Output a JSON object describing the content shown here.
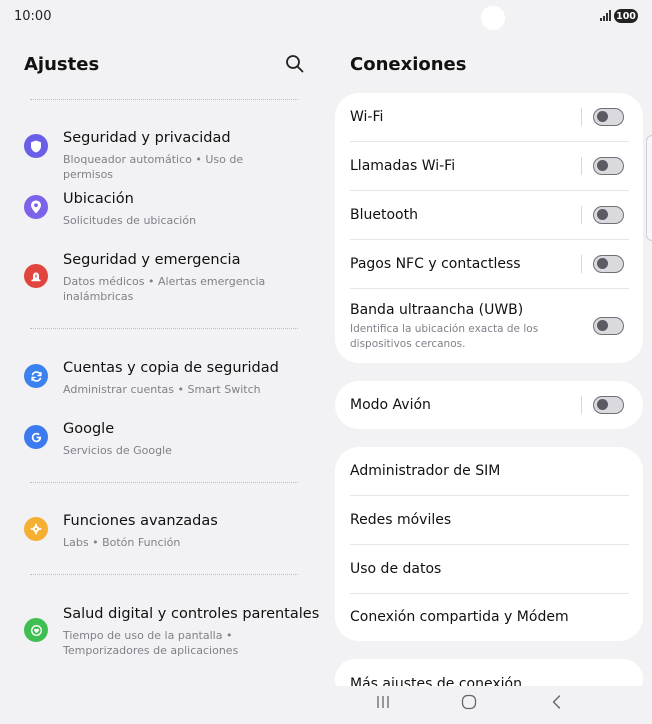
{
  "status_bar": {
    "time": "10:00",
    "battery": "100"
  },
  "settings": {
    "title": "Ajustes",
    "groups": [
      {
        "items": [
          {
            "title": "Seguridad y privacidad",
            "subtitle": "Bloqueador automático • Uso de permisos",
            "icon": "shield-icon",
            "color": "#6a5ee8"
          },
          {
            "title": "Ubicación",
            "subtitle": "Solicitudes de ubicación",
            "icon": "location-pin-icon",
            "color": "#7d62ea"
          },
          {
            "title": "Seguridad y emergencia",
            "subtitle": "Datos médicos • Alertas emergencia inalámbricas",
            "icon": "emergency-icon",
            "color": "#e0463d"
          }
        ]
      },
      {
        "items": [
          {
            "title": "Cuentas y copia de seguridad",
            "subtitle": "Administrar cuentas • Smart Switch",
            "icon": "sync-icon",
            "color": "#3c82ee"
          },
          {
            "title": "Google",
            "subtitle": "Servicios de Google",
            "icon": "google-icon",
            "color": "#3c7bef"
          }
        ]
      },
      {
        "items": [
          {
            "title": "Funciones avanzadas",
            "subtitle": "Labs • Botón Función",
            "icon": "advanced-features-icon",
            "color": "#f5b034"
          }
        ]
      },
      {
        "items": [
          {
            "title": "Salud digital y controles parentales",
            "subtitle": "Tiempo de uso de la pantalla • Temporizadores de aplicaciones",
            "icon": "digital-wellbeing-icon",
            "color": "#3fbf52"
          }
        ]
      }
    ]
  },
  "connections": {
    "title": "Conexiones",
    "card1": [
      {
        "label": "Wi-Fi",
        "toggle": false
      },
      {
        "label": "Llamadas Wi-Fi",
        "toggle": false
      },
      {
        "label": "Bluetooth",
        "toggle": false
      },
      {
        "label": "Pagos NFC y contactless",
        "toggle": false
      },
      {
        "label": "Banda ultraancha (UWB)",
        "sublabel": "Identifica la ubicación exacta de los dispositivos cercanos.",
        "toggle": false
      }
    ],
    "card2": [
      {
        "label": "Modo Avión",
        "toggle": false
      }
    ],
    "card3": [
      {
        "label": "Administrador de SIM"
      },
      {
        "label": "Redes móviles"
      },
      {
        "label": "Uso de datos"
      },
      {
        "label": "Conexión compartida y Módem"
      }
    ],
    "card4": [
      {
        "label": "Más ajustes de conexión"
      }
    ]
  },
  "nav": {
    "icons": [
      "recent-apps-icon",
      "home-icon",
      "back-icon"
    ]
  }
}
